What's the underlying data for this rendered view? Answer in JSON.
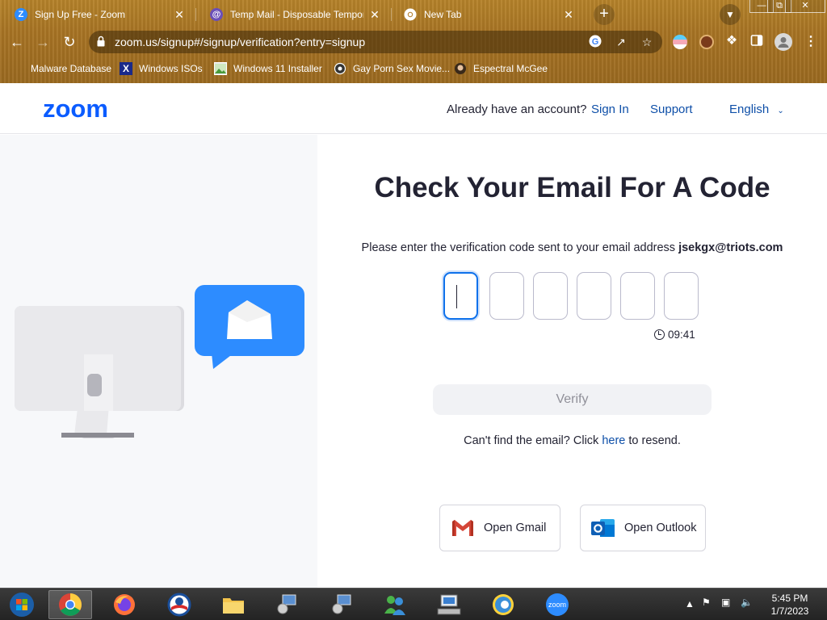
{
  "browser": {
    "tabs": [
      {
        "title": "Sign Up Free - Zoom",
        "icon": "zoom-favicon",
        "close": "✕"
      },
      {
        "title": "Temp Mail - Disposable Tempora",
        "icon": "tempmail-favicon",
        "close": "✕"
      },
      {
        "title": "New Tab",
        "icon": "chrome-favicon",
        "close": "✕"
      }
    ],
    "new_tab": "+",
    "url": "zoom.us/signup#/signup/verification?entry=signup",
    "bookmarks": [
      {
        "label": "Malware Database",
        "icon": "folder-icon"
      },
      {
        "label": "Windows ISOs",
        "icon": "x-icon"
      },
      {
        "label": "Windows 11 Installer",
        "icon": "image-icon"
      },
      {
        "label": "Gay Porn Sex Movie...",
        "icon": "site-icon"
      },
      {
        "label": "Espectral McGee",
        "icon": "avatar-icon"
      }
    ]
  },
  "header": {
    "logo": "zoom",
    "account_prompt": "Already have an account?",
    "sign_in": "Sign In",
    "support": "Support",
    "language": "English"
  },
  "verification": {
    "title": "Check Your Email For A Code",
    "instruction": "Please enter the verification code sent to your email address",
    "email": "jsekgx@triots.com",
    "code_digits": [
      "",
      "",
      "",
      "",
      "",
      ""
    ],
    "timer": "09:41",
    "verify_label": "Verify",
    "resend_prefix": "Can't find the email? Click",
    "resend_link": "here",
    "resend_suffix": "to resend.",
    "open_gmail": "Open Gmail",
    "open_outlook": "Open Outlook"
  },
  "taskbar": {
    "time": "5:45 PM",
    "date": "1/7/2023",
    "apps": [
      "start-orb",
      "chrome",
      "firefox",
      "obama-logo",
      "file-explorer",
      "network-setup",
      "network-setup-2",
      "msn-messenger",
      "keyboard-monitor",
      "browser-alt",
      "zoom"
    ],
    "zoom_label": "zoom"
  },
  "colors": {
    "zoom_blue": "#0b5cff",
    "link_blue": "#0e4fa8",
    "focus_blue": "#0e71eb",
    "bubble_blue": "#2d8cff"
  }
}
